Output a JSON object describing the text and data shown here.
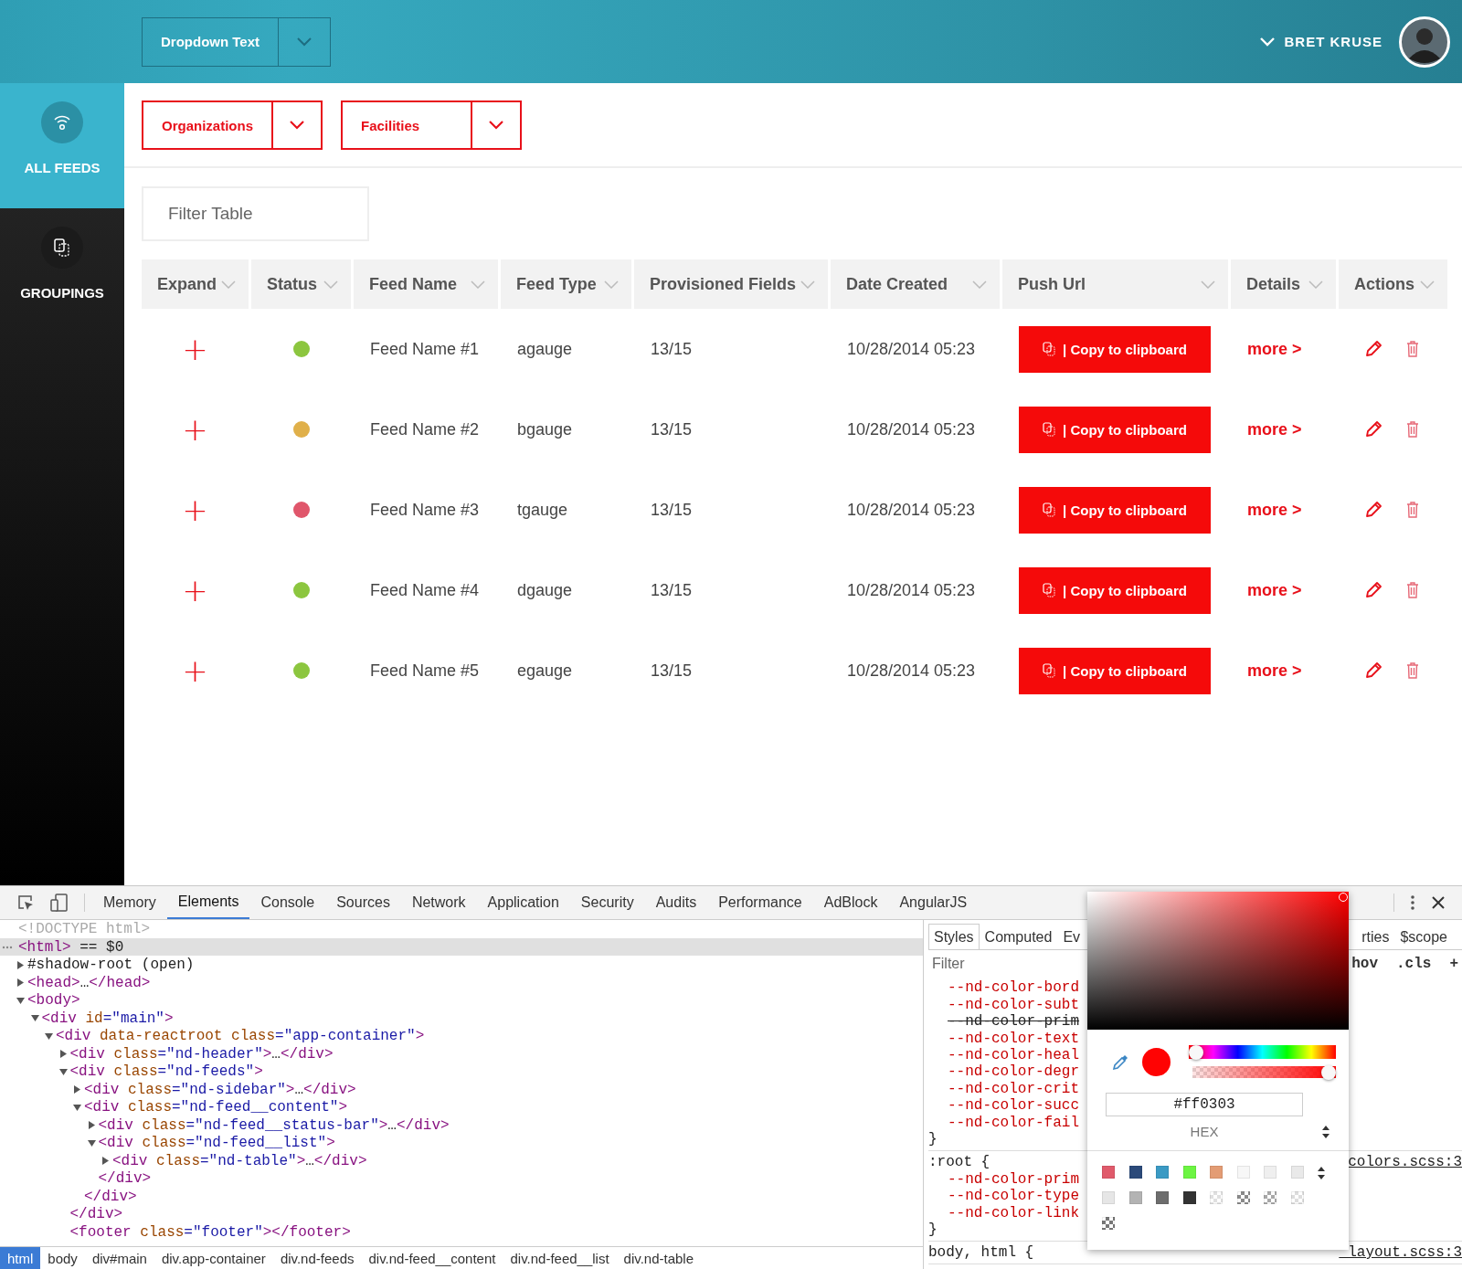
{
  "header": {
    "dropdown": {
      "label": "Dropdown Text"
    },
    "user": {
      "name": "BRET KRUSE"
    }
  },
  "sidebar": {
    "items": [
      {
        "label": "ALL FEEDS",
        "kind": "feeds",
        "selected": true
      },
      {
        "label": "GROUPINGS",
        "kind": "groupings",
        "selected": false
      }
    ]
  },
  "filters": [
    {
      "label": "Organizations"
    },
    {
      "label": "Facilities"
    }
  ],
  "filter_field": {
    "placeholder": "Filter Table"
  },
  "table": {
    "columns": [
      "Expand",
      "Status",
      "Feed Name",
      "Feed Type",
      "Provisioned Fields",
      "Date Created",
      "Push Url",
      "Details",
      "Actions"
    ],
    "rows": [
      {
        "expand": "+",
        "color": "#8cc63f",
        "feed_name": "Feed Name #1",
        "feed_type": "agauge",
        "provisioned": "13/15",
        "date_created": "10/28/2014 05:23",
        "push_label": "| Copy to clipboard",
        "details": "more >"
      },
      {
        "expand": "+",
        "color": "#e0b04a",
        "feed_name": "Feed Name #2",
        "feed_type": "bgauge",
        "provisioned": "13/15",
        "date_created": "10/28/2014 05:23",
        "push_label": "| Copy to clipboard",
        "details": "more >"
      },
      {
        "expand": "+",
        "color": "#e0566b",
        "feed_name": "Feed Name #3",
        "feed_type": "tgauge",
        "provisioned": "13/15",
        "date_created": "10/28/2014 05:23",
        "push_label": "| Copy to clipboard",
        "details": "more >"
      },
      {
        "expand": "+",
        "color": "#8cc63f",
        "feed_name": "Feed Name #4",
        "feed_type": "dgauge",
        "provisioned": "13/15",
        "date_created": "10/28/2014 05:23",
        "push_label": "| Copy to clipboard",
        "details": "more >"
      },
      {
        "expand": "+",
        "color": "#8cc63f",
        "feed_name": "Feed Name #5",
        "feed_type": "egauge",
        "provisioned": "13/15",
        "date_created": "10/28/2014 05:23",
        "push_label": "| Copy to clipboard",
        "details": "more >"
      }
    ]
  },
  "devtools": {
    "tabs": [
      {
        "label": "Memory",
        "selected": false
      },
      {
        "label": "Elements",
        "selected": true
      },
      {
        "label": "Console",
        "selected": false
      },
      {
        "label": "Sources",
        "selected": false
      },
      {
        "label": "Network",
        "selected": false
      },
      {
        "label": "Application",
        "selected": false
      },
      {
        "label": "Security",
        "selected": false
      },
      {
        "label": "Audits",
        "selected": false
      },
      {
        "label": "Performance",
        "selected": false
      },
      {
        "label": "AdBlock",
        "selected": false
      },
      {
        "label": "AngularJS",
        "selected": false
      }
    ],
    "tree": [
      {
        "text": "<!DOCTYPE html>",
        "kind": "doctype",
        "selected": false
      },
      {
        "text": "<html> == $0",
        "kind": "root",
        "selected": true,
        "children": [
          {
            "text": "#shadow-root (open)",
            "kind": "branch",
            "expanded": false,
            "selected": false
          },
          {
            "text": "<head>…</head>",
            "kind": "branch",
            "expanded": false,
            "selected": false
          },
          {
            "text": "<body>",
            "kind": "branch",
            "expanded": true,
            "selected": false,
            "children": [
              {
                "text": "<div id=\"main\">",
                "kind": "branch",
                "expanded": true,
                "selected": false,
                "children": [
                  {
                    "text": "<div data-reactroot class=\"app-container\">",
                    "kind": "branch",
                    "expanded": true,
                    "selected": false,
                    "children": [
                      {
                        "text": "<div class=\"nd-header\">…</div>",
                        "kind": "branch",
                        "expanded": false,
                        "selected": false
                      },
                      {
                        "text": "<div class=\"nd-feeds\">",
                        "kind": "branch",
                        "expanded": true,
                        "selected": false,
                        "close": "</div>",
                        "children": [
                          {
                            "text": "<div class=\"nd-sidebar\">…</div>",
                            "kind": "branch",
                            "expanded": false,
                            "selected": false
                          },
                          {
                            "text": "<div class=\"nd-feed__content\">",
                            "kind": "branch",
                            "expanded": true,
                            "selected": false,
                            "close": "</div>",
                            "children": [
                              {
                                "text": "<div class=\"nd-feed__status-bar\">…</div>",
                                "kind": "branch",
                                "expanded": false,
                                "selected": false
                              },
                              {
                                "text": "<div class=\"nd-feed__list\">",
                                "kind": "branch",
                                "expanded": true,
                                "selected": false,
                                "close": "</div>",
                                "children": [
                                  {
                                    "text": "<div class=\"nd-table\">…</div>",
                                    "kind": "branch",
                                    "expanded": false,
                                    "selected": false
                                  }
                                ]
                              }
                            ]
                          }
                        ]
                      },
                      {
                        "text": "<footer class=\"footer\"></footer>",
                        "kind": "leaf",
                        "selected": false
                      }
                    ]
                  }
                ]
              }
            ]
          }
        ]
      }
    ],
    "breadcrumbs": [
      {
        "label": "html",
        "selected": true
      },
      {
        "label": "body",
        "selected": false
      },
      {
        "label": "div#main",
        "selected": false
      },
      {
        "label": "div.app-container",
        "selected": false
      },
      {
        "label": "div.nd-feeds",
        "selected": false
      },
      {
        "label": "div.nd-feed__content",
        "selected": false
      },
      {
        "label": "div.nd-feed__list",
        "selected": false
      },
      {
        "label": "div.nd-table",
        "selected": false
      }
    ],
    "styles": {
      "tabs_left": [
        {
          "label": "Styles",
          "selected": true
        },
        {
          "label": "Computed",
          "selected": false
        },
        {
          "label": "Ev",
          "selected": false
        }
      ],
      "tabs_right": [
        {
          "label": "rties",
          "selected": false
        },
        {
          "label": "$scope",
          "selected": false
        }
      ],
      "filter": {
        "placeholder": "Filter"
      },
      "tools": [
        "hov",
        ".cls",
        "+"
      ],
      "rules": [
        {
          "lines": [
            {
              "text": "--nd-color-bord",
              "struck": false
            },
            {
              "text": "--nd-color-subt",
              "struck": false
            },
            {
              "text": "--nd-color-prim",
              "struck": true
            },
            {
              "text": "--nd-color-text",
              "struck": false
            },
            {
              "text": "--nd-color-heal",
              "struck": false
            },
            {
              "text": "--nd-color-degr",
              "struck": false
            },
            {
              "text": "--nd-color-crit",
              "struck": false
            },
            {
              "text": "--nd-color-succ",
              "struck": false
            },
            {
              "text": "--nd-color-fail",
              "struck": false
            }
          ],
          "close": "}"
        },
        {
          "selector": ":root {",
          "source": "colors.scss:3",
          "lines": [
            {
              "text": "--nd-color-prim",
              "struck": false
            },
            {
              "text": "--nd-color-type",
              "struck": false
            },
            {
              "text": "--nd-color-link",
              "struck": false
            }
          ],
          "close": "}"
        },
        {
          "selector": "body, html {",
          "source": "_layout.scss:3"
        }
      ]
    },
    "color_picker": {
      "hex": "#ff0303",
      "format": "HEX",
      "hue": {
        "level": 0
      },
      "alpha": {
        "level": 1
      },
      "swatches": [
        {
          "kind": "solid",
          "color": "#e05a6b"
        },
        {
          "kind": "solid",
          "color": "#2b4a7a"
        },
        {
          "kind": "solid",
          "color": "#3a9ac4"
        },
        {
          "kind": "solid",
          "color": "#6cf542"
        },
        {
          "kind": "solid",
          "color": "#e39c74"
        },
        {
          "kind": "solid",
          "color": "#f7f7f7"
        },
        {
          "kind": "solid",
          "color": "#efefef"
        },
        {
          "kind": "solid",
          "color": "#e9e9e9"
        },
        {
          "kind": "solid",
          "color": "#e6e6e6"
        },
        {
          "kind": "solid",
          "color": "#b3b3b3"
        },
        {
          "kind": "solid",
          "color": "#6d6d6d"
        },
        {
          "kind": "solid",
          "color": "#333333"
        },
        {
          "kind": "checker",
          "color": "#e0e0e0"
        },
        {
          "kind": "checker",
          "color": "#8a8a8a"
        },
        {
          "kind": "checker",
          "color": "#a8a8a8"
        },
        {
          "kind": "checker",
          "color": "#dddddd"
        },
        {
          "kind": "checker",
          "color": "#777777"
        }
      ]
    }
  }
}
